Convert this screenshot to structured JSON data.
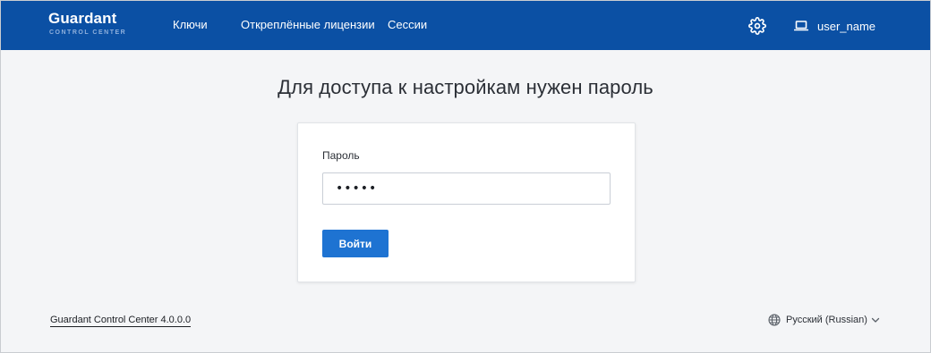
{
  "header": {
    "logo_main": "Guardant",
    "logo_sub": "CONTROL CENTER",
    "nav": [
      "Ключи",
      "Откреплённые лицензии",
      "Сессии"
    ],
    "settings_icon": "gear-icon",
    "user_icon": "laptop-icon",
    "user_name": "user_name",
    "color": "#0b50a4"
  },
  "main": {
    "title": "Для доступа к настройкам нужен пароль",
    "password_label": "Пароль",
    "password_value": "•••••",
    "login_button": "Войти",
    "button_color": "#1e73d2"
  },
  "footer": {
    "version": "Guardant Control Center 4.0.0.0",
    "language": "Русский (Russian)",
    "language_icon": "globe-icon"
  }
}
